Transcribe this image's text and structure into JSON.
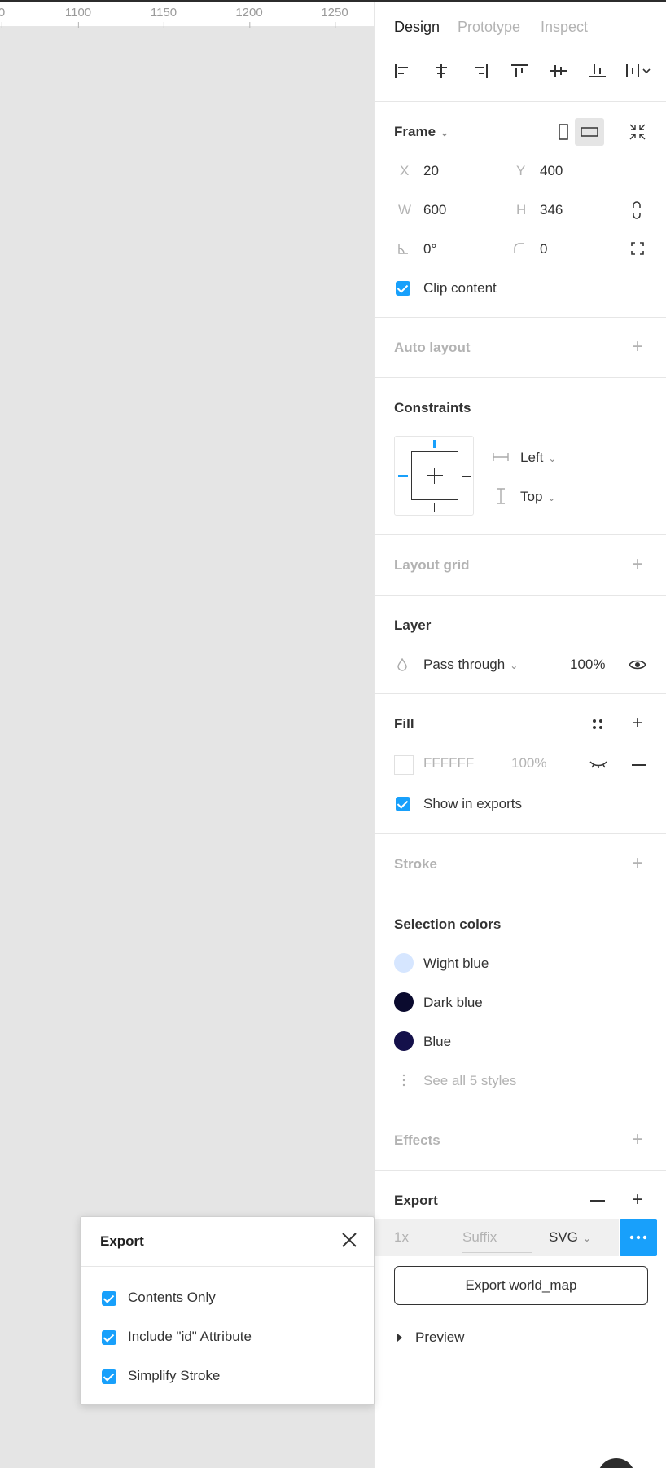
{
  "ruler": {
    "ticks": [
      "0",
      "1100",
      "1150",
      "1200",
      "1250"
    ]
  },
  "tabs": [
    {
      "label": "Design",
      "active": true
    },
    {
      "label": "Prototype",
      "active": false
    },
    {
      "label": "Inspect",
      "active": false
    }
  ],
  "align_icons": [
    "align-left-icon",
    "align-horizontal-center-icon",
    "align-right-icon",
    "align-top-icon",
    "align-vertical-center-icon",
    "align-bottom-icon",
    "distribute-icon"
  ],
  "frame": {
    "title": "Frame",
    "x_label": "X",
    "x": "20",
    "y_label": "Y",
    "y": "400",
    "w_label": "W",
    "w": "600",
    "h_label": "H",
    "h": "346",
    "rotation": "0°",
    "radius": "0",
    "clip_content": "Clip content"
  },
  "auto_layout": {
    "title": "Auto layout"
  },
  "constraints": {
    "title": "Constraints",
    "horizontal": "Left",
    "vertical": "Top"
  },
  "layout_grid": {
    "title": "Layout grid"
  },
  "layer": {
    "title": "Layer",
    "blend": "Pass through",
    "opacity": "100%"
  },
  "fill": {
    "title": "Fill",
    "hex": "FFFFFF",
    "opacity": "100%",
    "show_in_exports": "Show in exports"
  },
  "stroke": {
    "title": "Stroke"
  },
  "selection_colors": {
    "title": "Selection colors",
    "items": [
      {
        "name": "Wight blue",
        "color": "#d6e6ff"
      },
      {
        "name": "Dark blue",
        "color": "#0a0a2e"
      },
      {
        "name": "Blue",
        "color": "#14104a"
      }
    ],
    "see_all": "See all 5 styles"
  },
  "effects": {
    "title": "Effects"
  },
  "export": {
    "title": "Export",
    "scale": "1x",
    "suffix_placeholder": "Suffix",
    "format": "SVG",
    "export_button": "Export world_map",
    "preview": "Preview"
  },
  "export_popup": {
    "title": "Export",
    "options": [
      "Contents Only",
      "Include \"id\" Attribute",
      "Simplify Stroke"
    ]
  },
  "colors": {
    "accent": "#18a0fb",
    "panel_bg": "#ffffff",
    "canvas_bg": "#e5e5e5"
  }
}
